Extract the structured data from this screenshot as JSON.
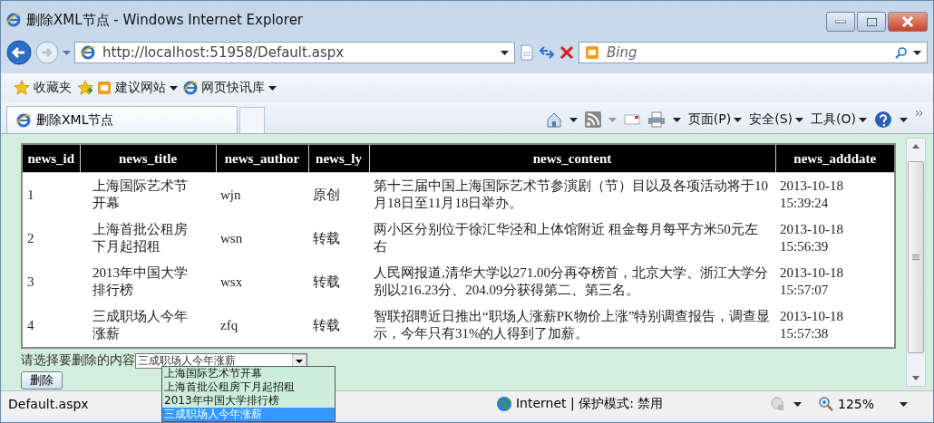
{
  "window": {
    "title": "删除XML节点 - Windows Internet Explorer"
  },
  "address_bar": {
    "url": "http://localhost:51958/Default.aspx"
  },
  "search": {
    "placeholder": "Bing"
  },
  "favorites_bar": {
    "items": [
      "收藏夹",
      "建议网站",
      "网页快讯库"
    ]
  },
  "tab": {
    "title": "删除XML节点"
  },
  "command_bar": {
    "items": [
      "页面(P)",
      "安全(S)",
      "工具(O)"
    ]
  },
  "table": {
    "columns": [
      "news_id",
      "news_title",
      "news_author",
      "news_ly",
      "news_content",
      "news_adddate"
    ],
    "rows": [
      [
        "1",
        "上海国际艺术节开幕",
        "wjn",
        "原创",
        "第十三届中国上海国际艺术节参演剧（节）目以及各项活动将于10月18日至11月18日举办。",
        "2013-10-18 15:39:24"
      ],
      [
        "2",
        "上海首批公租房下月起招租",
        "wsn",
        "转载",
        "两小区分别位于徐汇华泾和上体馆附近 租金每月每平方米50元左右",
        "2013-10-18 15:56:39"
      ],
      [
        "3",
        "2013年中国大学排行榜",
        "wsx",
        "转载",
        "人民网报道,清华大学以271.00分再夺榜首，北京大学、浙江大学分别以216.23分、204.09分获得第二、第三名。",
        "2013-10-18 15:57:07"
      ],
      [
        "4",
        "三成职场人今年涨薪",
        "zfq",
        "转载",
        "智联招聘近日推出“职场人涨薪PK物价上涨”特别调查报告，调查显示，今年只有31%的人得到了加薪。",
        "2013-10-18 15:57:38"
      ]
    ]
  },
  "delete_form": {
    "label": "请选择要删除的内容",
    "select_value": "三成职场人今年涨薪",
    "options": [
      {
        "label": "上海国际艺术节开幕",
        "selected": false
      },
      {
        "label": "上海首批公租房下月起招租",
        "selected": false
      },
      {
        "label": "2013年中国大学排行榜",
        "selected": false
      },
      {
        "label": "三成职场人今年涨薪",
        "selected": true
      }
    ],
    "button": "删除"
  },
  "status_bar": {
    "url": "Default.aspx",
    "zone": "Internet | 保护模式: 禁用",
    "zoom": "125%"
  }
}
